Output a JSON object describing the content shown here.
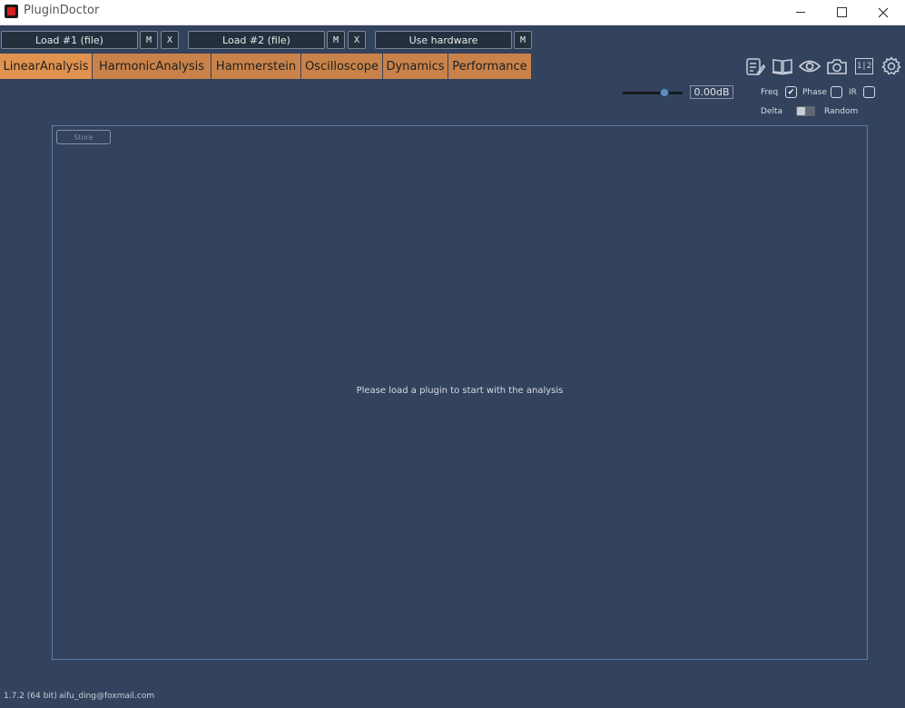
{
  "window": {
    "title": "PluginDoctor"
  },
  "loadbar": {
    "load1_label": "Load #1 (file)",
    "load2_label": "Load #2 (file)",
    "hardware_label": "Use hardware",
    "m_label": "M",
    "x_label": "X"
  },
  "tabs": [
    {
      "label": "LinearAnalysis",
      "active": true
    },
    {
      "label": "HarmonicAnalysis"
    },
    {
      "label": "Hammerstein"
    },
    {
      "label": "Oscilloscope"
    },
    {
      "label": "Dynamics"
    },
    {
      "label": "Performance"
    }
  ],
  "toolbar_icons": [
    "notes-edit-icon",
    "book-icon",
    "eye-icon",
    "camera-icon",
    "one-two-icon",
    "gear-icon"
  ],
  "toolbar": {
    "one_two_label": "1|2"
  },
  "gain": {
    "value": "0.00dB",
    "slider_fraction": 0.7
  },
  "options": {
    "freq_label": "Freq",
    "freq_checked": true,
    "phase_label": "Phase",
    "phase_checked": false,
    "ir_label": "IR",
    "ir_checked": false,
    "delta_label": "Delta",
    "random_label": "Random"
  },
  "plot": {
    "store_label": "Store",
    "empty_message": "Please load a plugin to start with the analysis"
  },
  "footer": {
    "version": "1.7.2 (64 bit)",
    "email": "aifu_ding@foxmail.com"
  },
  "colors": {
    "background": "#33425d",
    "tab": "#c9834a",
    "tab_active": "#e0924f",
    "panel_border": "#5a7fa8"
  }
}
